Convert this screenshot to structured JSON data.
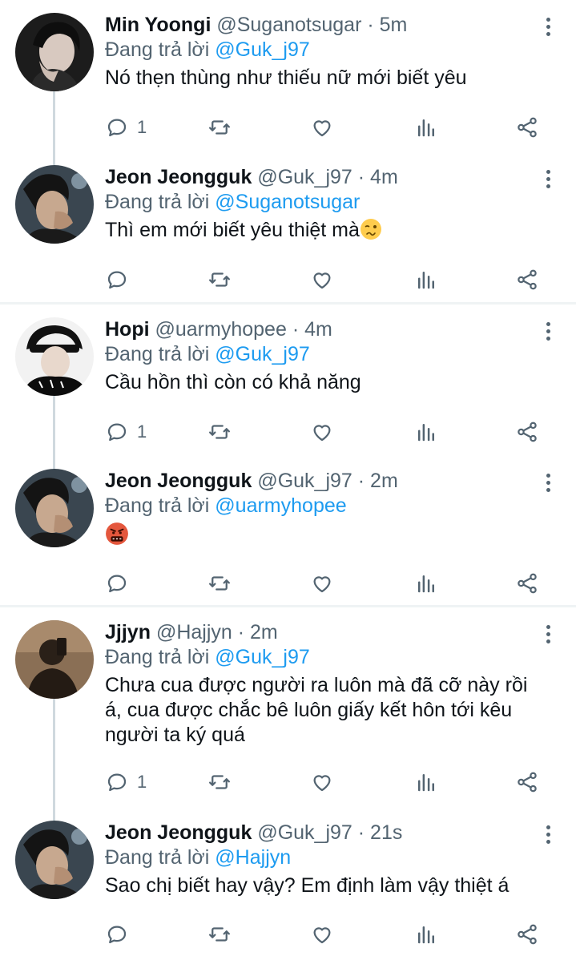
{
  "replying_prefix": "Đang trả lời",
  "colors": {
    "link": "#1d9bf0",
    "muted": "#536471",
    "text": "#0f1419",
    "divider": "#eff3f4"
  },
  "tweets": [
    {
      "name": "Min Yoongi",
      "handle": "@Suganotsugar",
      "time": "· 5m",
      "reply_to": "@Guk_j97",
      "text": "Nó thẹn thùng như thiếu nữ mới biết yêu",
      "reply_count": "1"
    },
    {
      "name": "Jeon Jeongguk",
      "handle": "@Guk_j97",
      "time": "· 4m",
      "reply_to": "@Suganotsugar",
      "text": "Thì em mới biết yêu thiệt mà",
      "emoji": "woozy-face",
      "reply_count": ""
    },
    {
      "name": "Hopi",
      "handle": "@uarmyhopee",
      "time": "· 4m",
      "reply_to": "@Guk_j97",
      "text": "Cầu hồn thì còn có khả năng",
      "reply_count": "1"
    },
    {
      "name": "Jeon Jeongguk",
      "handle": "@Guk_j97",
      "time": "· 2m",
      "reply_to": "@uarmyhopee",
      "text": "",
      "emoji": "face-with-symbols-on-mouth",
      "reply_count": ""
    },
    {
      "name": "Jjjyn",
      "handle": "@Hajjyn",
      "time": "· 2m",
      "reply_to": "@Guk_j97",
      "text": "Chưa cua được người ra luôn mà đã cỡ này rồi á, cua được chắc bê luôn giấy kết hôn tới kêu người ta ký quá",
      "reply_count": "1"
    },
    {
      "name": "Jeon Jeongguk",
      "handle": "@Guk_j97",
      "time": "· 21s",
      "reply_to": "@Hajjyn",
      "text": "Sao chị biết hay vậy? Em định làm vậy thiệt á",
      "reply_count": ""
    }
  ]
}
